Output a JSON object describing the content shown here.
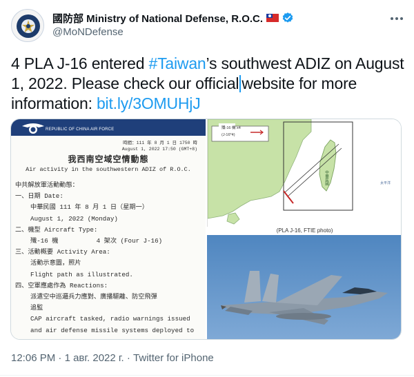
{
  "author": {
    "name": "國防部 Ministry of National Defense, R.O.C.",
    "handle": "@MoNDefense",
    "avatar_icon": "ministry-emblem-icon",
    "flag_icon": "taiwan-flag-icon",
    "verified_icon": "verified-badge-icon"
  },
  "tweet": {
    "text_before_hashtag": "4 PLA J-16 entered ",
    "hashtag": "#Taiwan",
    "text_after_hashtag": "’s southwest ADIZ on August 1, 2022. Please check our official",
    "text_after_caret": "website for more information: ",
    "link": "bit.ly/3OMUHjJ"
  },
  "media": {
    "doc_band_text": "REPUBLIC OF CHINA AIR FORCE",
    "doc_meta_line1": "時間：111 年 8 月 1 日 1750 時",
    "doc_meta_line2": "August 1, 2022 17:50 (GMT+8)",
    "doc_title": "我西南空域空情動態",
    "doc_subtitle": "Air activity in the southwestern ADIZ of R.O.C.",
    "doc_lines": [
      "中共解放軍活動動態：",
      "一、日期 Date:",
      "    中華民國 111 年 8 月 1 日（星期一）",
      "    August 1, 2022 (Monday)",
      "二、機型 Aircraft Type:",
      "    殲-16 機          4 架次 (Four J-16)",
      "三、活動概要 Activity Area:",
      "    活動示意圖，照片",
      "    Flight path as illustrated.",
      "四、空軍應處作為 Reactions:",
      "    派遣空中巡邏兵力應對、廣播驅離、防空飛彈",
      "    追監",
      "    CAP aircraft tasked, radio warnings issued",
      "    and air defense missile systems deployed to"
    ],
    "map_legend_line1": "殲-16 機 x4",
    "map_legend_line2": "(J-16*4)",
    "map_island_label": "中華民國",
    "map_ocean_label": "太平洋",
    "photo_caption": "(PLA J-16, FTIE photo)",
    "photo_subject": "fighter-jet-photo"
  },
  "footer": {
    "time": "12:06 PM",
    "separator": " · ",
    "date": "1 авг. 2022 г.",
    "source": "Twitter for iPhone"
  },
  "colors": {
    "accent": "#1d9bf0",
    "text": "#0f1419",
    "secondary": "#536471",
    "doc_band": "#1f3f7a",
    "map_land": "#c7e2a7",
    "sky": "#5c8fc4"
  }
}
